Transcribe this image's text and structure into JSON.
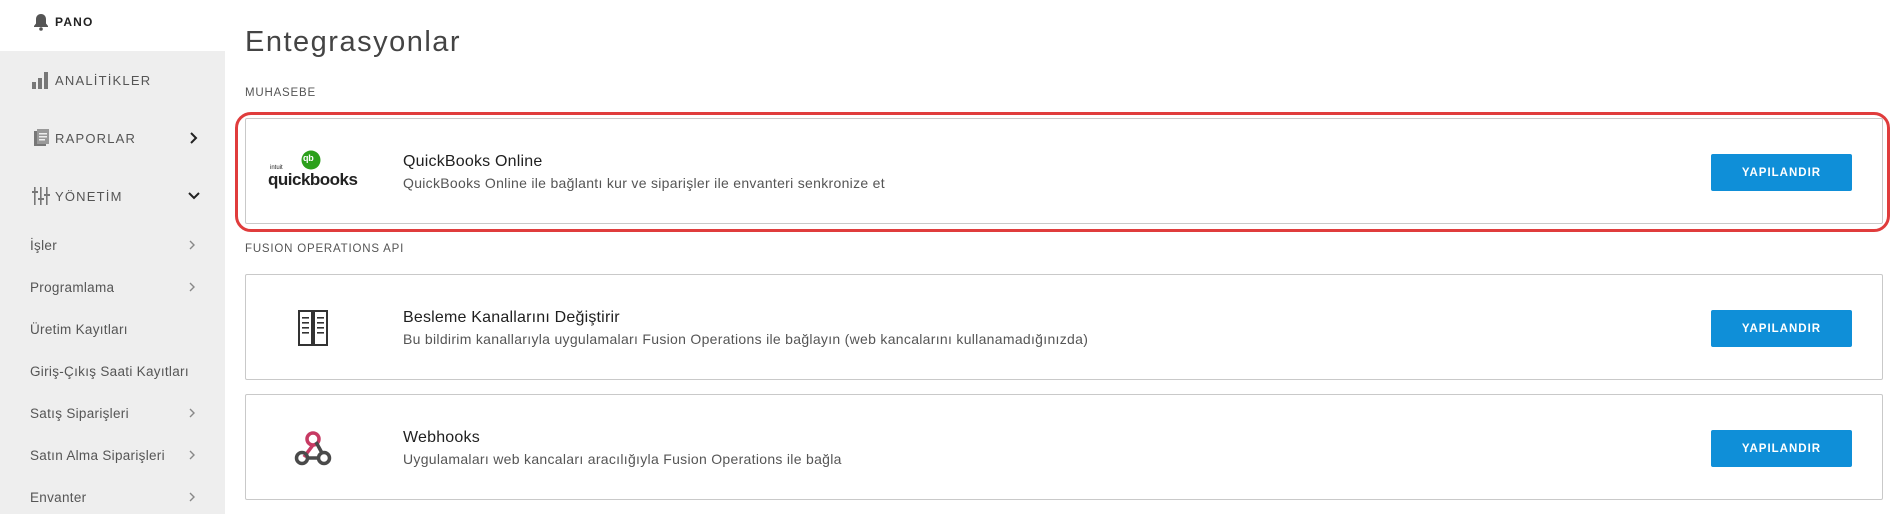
{
  "sidebar": {
    "main_items": [
      {
        "label": "PANO",
        "icon": "bell-icon"
      },
      {
        "label": "ANALİTİKLER",
        "icon": "bar-chart-icon"
      },
      {
        "label": "RAPORLAR",
        "icon": "report-icon"
      },
      {
        "label": "YÖNETİM",
        "icon": "sliders-icon"
      }
    ],
    "sub_items": [
      {
        "label": "İşler"
      },
      {
        "label": "Programlama"
      },
      {
        "label": "Üretim Kayıtları"
      },
      {
        "label": "Giriş-Çıkış Saati Kayıtları"
      },
      {
        "label": "Satış Siparişleri"
      },
      {
        "label": "Satın Alma Siparişleri"
      },
      {
        "label": "Envanter"
      }
    ]
  },
  "main": {
    "title": "Entegrasyonlar",
    "sections": [
      {
        "label": "MUHASEBE",
        "cards": [
          {
            "logo_text": "quickbooks",
            "logo_small": "intuit",
            "logo_badge": "qb",
            "title": "QuickBooks Online",
            "description": "QuickBooks Online ile bağlantı kur ve siparişler ile envanteri senkronize et",
            "button": "YAPILANDIR",
            "icon": "quickbooks-logo-icon"
          }
        ]
      },
      {
        "label": "FUSION OPERATIONS API",
        "cards": [
          {
            "title": "Besleme Kanallarını Değiştirir",
            "description": "Bu bildirim kanallarıyla uygulamaları Fusion Operations ile bağlayın (web kancalarını kullanamadığınızda)",
            "button": "YAPILANDIR",
            "icon": "feed-channels-icon"
          },
          {
            "title": "Webhooks",
            "description": "Uygulamaları web kancaları aracılığıyla Fusion Operations ile bağla",
            "button": "YAPILANDIR",
            "icon": "webhooks-icon"
          }
        ]
      }
    ]
  },
  "colors": {
    "accent": "#0f8fd8",
    "highlight": "#e03c3c",
    "sidebar_bg": "#eeeeee",
    "quickbooks_green": "#2ca01c",
    "webhook_pink": "#c73a63"
  }
}
